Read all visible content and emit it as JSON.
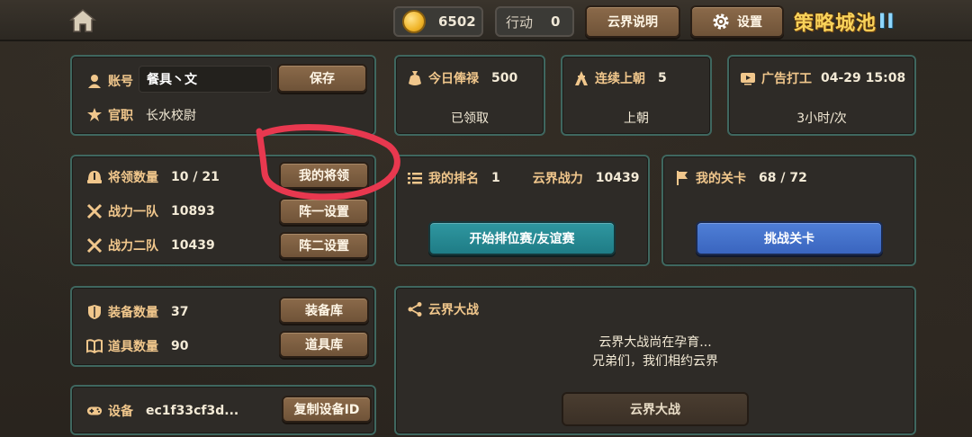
{
  "topbar": {
    "coins": "6502",
    "action_label": "行动",
    "action_value": "0",
    "cloud_help_button": "云界说明",
    "settings_button": "设置",
    "logo_text": "策略城池",
    "logo_roman": "II"
  },
  "account": {
    "account_label": "账号",
    "account_value": "餐具丶文",
    "save_button": "保存",
    "rank_label": "官职",
    "rank_value": "长水校尉"
  },
  "generals": {
    "count_label": "将领数量",
    "count_value": "10 / 21",
    "my_generals_button": "我的将领",
    "team1_label": "战力一队",
    "team1_value": "10893",
    "team1_button": "阵一设置",
    "team2_label": "战力二队",
    "team2_value": "10439",
    "team2_button": "阵二设置"
  },
  "equipment": {
    "equip_label": "装备数量",
    "equip_value": "37",
    "equip_button": "装备库",
    "items_label": "道具数量",
    "items_value": "90",
    "items_button": "道具库"
  },
  "device": {
    "label": "设备",
    "value": "ec1f33cf3d...",
    "copy_button": "复制设备ID"
  },
  "salary": {
    "label": "今日俸禄",
    "value": "500",
    "status": "已领取"
  },
  "court": {
    "label": "连续上朝",
    "value": "5",
    "status": "上朝"
  },
  "ad": {
    "label": "广告打工",
    "value": "04-29 15:08",
    "status": "3小时/次"
  },
  "ranking": {
    "rank_label": "我的排名",
    "rank_value": "1",
    "power_label": "云界战力",
    "power_value": "10439",
    "button": "开始排位赛/友谊赛"
  },
  "stage": {
    "label": "我的关卡",
    "value": "68 / 72",
    "button": "挑战关卡"
  },
  "cloudwar": {
    "title": "云界大战",
    "line1": "云界大战尚在孕育...",
    "line2": "兄弟们，我们相约云界",
    "button": "云界大战"
  },
  "colors": {
    "panel_border": "#3f675f",
    "label_gold": "#f1c78c",
    "teal_button": "#1f7c86",
    "blue_button": "#3a65bf",
    "annotation_red": "#e8384f"
  }
}
